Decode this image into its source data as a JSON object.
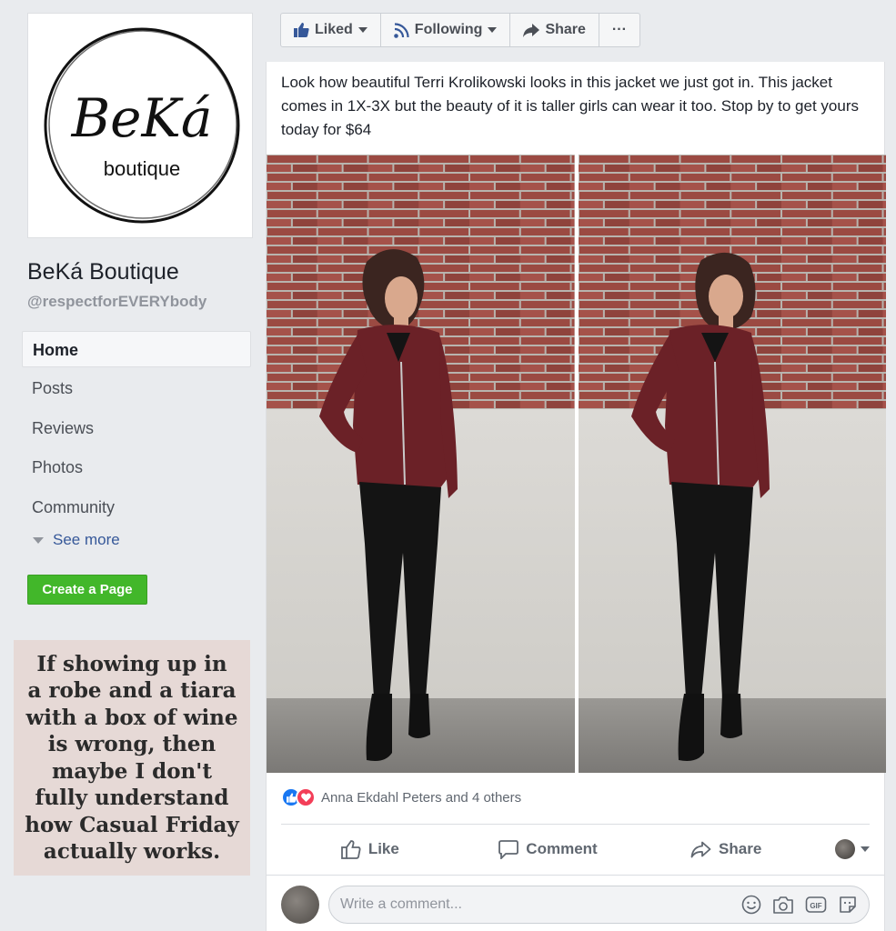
{
  "sidebar": {
    "logo_brand": "BeKá",
    "logo_sub": "boutique",
    "page_name": "BeKá Boutique",
    "handle": "@respectforEVERYbody",
    "nav": [
      "Home",
      "Posts",
      "Reviews",
      "Photos",
      "Community"
    ],
    "see_more": "See more",
    "create_page": "Create a Page",
    "quote_lines": [
      "If showing up in",
      "a robe and a tiara",
      "with a box of wine",
      "is wrong, then",
      "maybe I don't",
      "fully understand",
      "how Casual Friday",
      "actually works."
    ]
  },
  "toolbar": {
    "liked": "Liked",
    "following": "Following",
    "share": "Share",
    "more": "···"
  },
  "post": {
    "text": "Look how beautiful Terri Krolikowski looks in this jacket we just got in. This jacket comes in 1X-3X but the beauty of it is taller girls can wear it too. Stop by to get yours today for $64",
    "reactions_text": "Anna Ekdahl Peters and 4 others",
    "actions": {
      "like": "Like",
      "comment": "Comment",
      "share": "Share"
    },
    "comment_placeholder": "Write a comment..."
  },
  "colors": {
    "accent": "#365899",
    "green": "#42b72a",
    "like_blue": "#1877f2",
    "love_red": "#f33e58",
    "jacket": "#6b2127"
  }
}
